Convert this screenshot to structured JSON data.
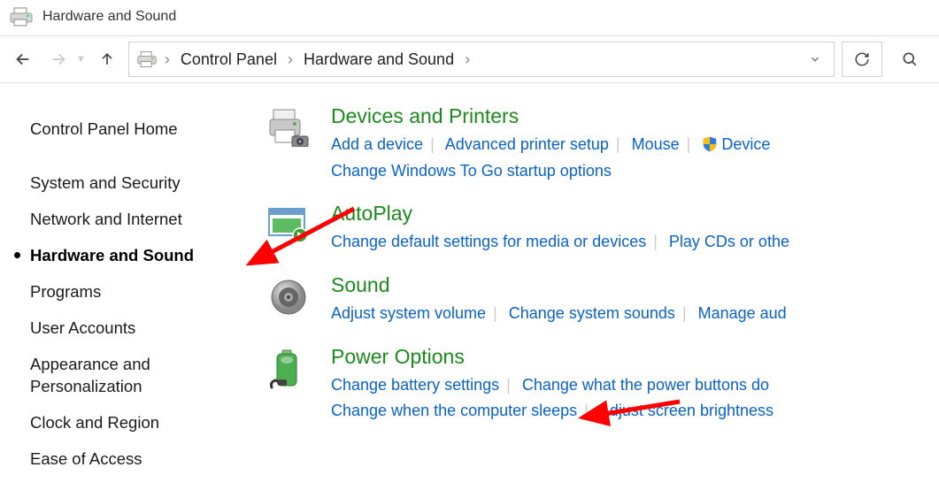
{
  "window": {
    "title": "Hardware and Sound"
  },
  "breadcrumb": {
    "items": [
      "Control Panel",
      "Hardware and Sound"
    ]
  },
  "sidebar": {
    "home": "Control Panel Home",
    "items": [
      {
        "label": "System and Security"
      },
      {
        "label": "Network and Internet"
      },
      {
        "label": "Hardware and Sound",
        "active": true
      },
      {
        "label": "Programs"
      },
      {
        "label": "User Accounts"
      },
      {
        "label": "Appearance and Personalization"
      },
      {
        "label": "Clock and Region"
      },
      {
        "label": "Ease of Access"
      }
    ]
  },
  "categories": [
    {
      "icon": "printer-icon",
      "title": "Devices and Printers",
      "links": [
        {
          "label": "Add a device"
        },
        {
          "label": "Advanced printer setup"
        },
        {
          "label": "Mouse"
        },
        {
          "label": "Device",
          "shield": true
        }
      ],
      "links2": [
        {
          "label": "Change Windows To Go startup options"
        }
      ]
    },
    {
      "icon": "autoplay-icon",
      "title": "AutoPlay",
      "links": [
        {
          "label": "Change default settings for media or devices"
        },
        {
          "label": "Play CDs or othe"
        }
      ]
    },
    {
      "icon": "speaker-icon",
      "title": "Sound",
      "links": [
        {
          "label": "Adjust system volume"
        },
        {
          "label": "Change system sounds"
        },
        {
          "label": "Manage aud"
        }
      ]
    },
    {
      "icon": "battery-icon",
      "title": "Power Options",
      "links": [
        {
          "label": "Change battery settings"
        },
        {
          "label": "Change what the power buttons do"
        }
      ],
      "links2": [
        {
          "label": "Change when the computer sleeps"
        },
        {
          "label": "Adjust screen brightness"
        }
      ]
    }
  ]
}
